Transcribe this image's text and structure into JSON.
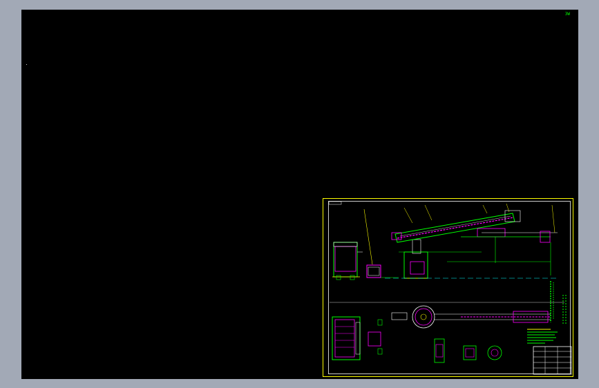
{
  "viewer": {
    "corner_label": "3W"
  },
  "colors": {
    "background_frame": "#a2a9b6",
    "canvas": "#000000",
    "sheet_border": "#ffff00",
    "primary": "#00ff00",
    "magenta": "#ff00ff",
    "white": "#ffffff",
    "cyan": "#00ffff"
  },
  "icons": {
    "sheet": "cad-drawing-sheet"
  }
}
